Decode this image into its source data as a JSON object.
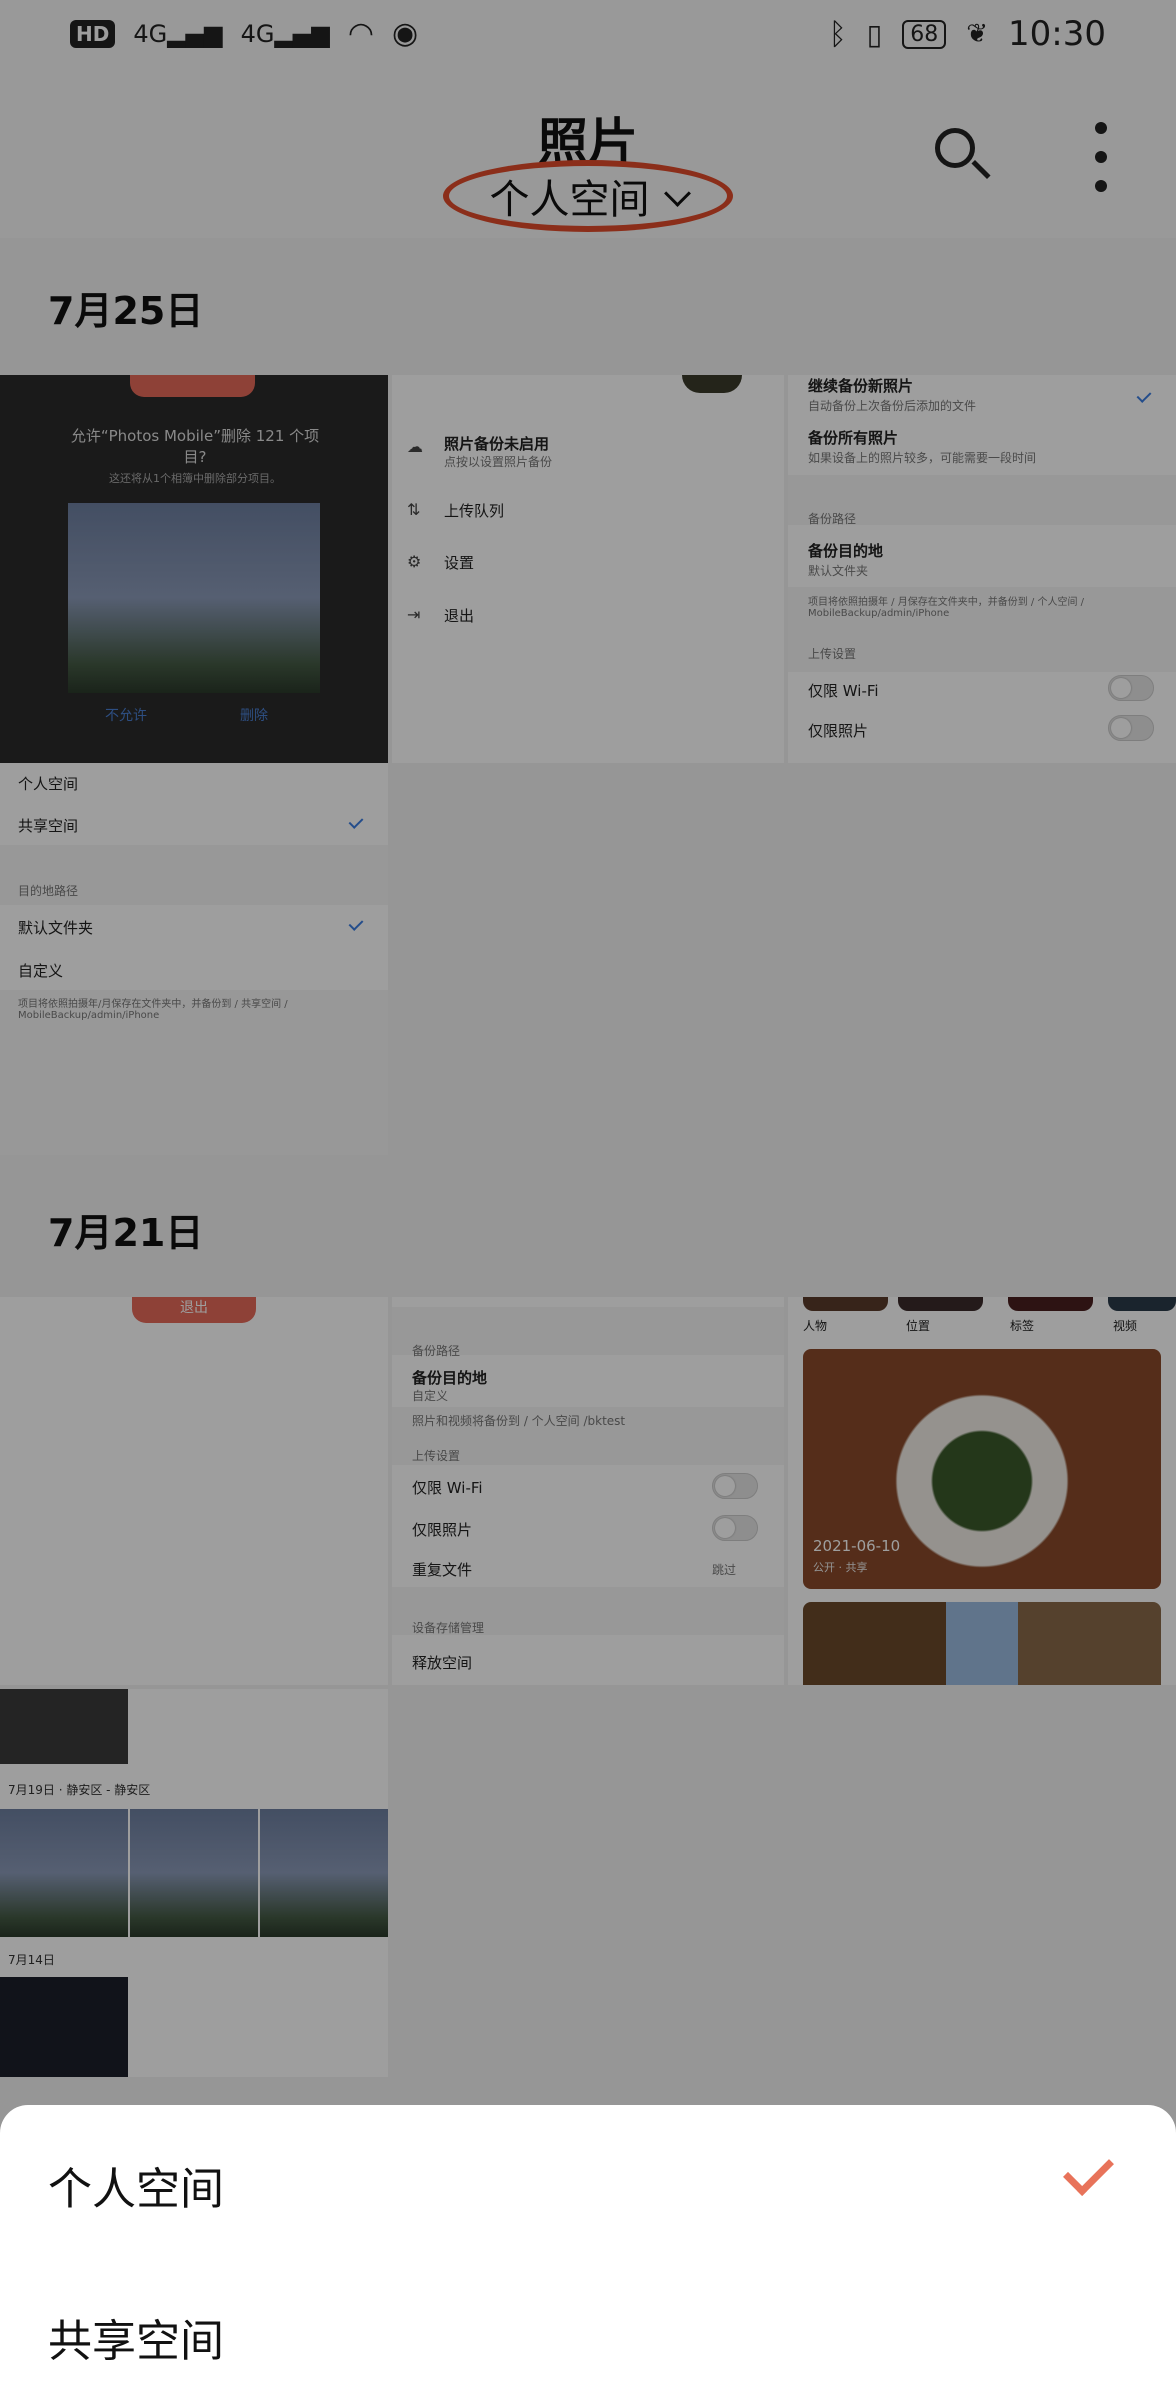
{
  "status_bar": {
    "hd": "HD",
    "sig1": "4G",
    "sig2": "4G",
    "battery": "68",
    "time": "10:30"
  },
  "app_bar": {
    "title": "照片",
    "space_selector": "个人空间"
  },
  "sections": [
    {
      "date": "7月25日"
    },
    {
      "date": "7月21日"
    }
  ],
  "thumb1": {
    "dialog_title": "允许“Photos Mobile”删除 121 个项目?",
    "dialog_sub": "这还将从1个相簿中删除部分项目。",
    "deny": "不允许",
    "delete": "删除",
    "rows": [
      "个人空间",
      "共享空间",
      "目的地路径",
      "默认文件夹",
      "自定义"
    ],
    "footer": "项目将依照拍摄年/月保存在文件夹中，并备份到 / 共享空间 / MobileBackup/admin/iPhone"
  },
  "thumb2": {
    "items": [
      "照片备份未启用",
      "上传队列",
      "设置",
      "退出"
    ],
    "sub": "点按以设置照片备份"
  },
  "thumb3": {
    "r1": "继续备份新照片",
    "r1s": "自动备份上次备份后添加的文件",
    "r2": "备份所有照片",
    "r2s": "如果设备上的照片较多，可能需要一段时间",
    "sec1": "备份路径",
    "r3": "备份目的地",
    "r3s": "默认文件夹",
    "note": "项目将依照拍摄年 / 月保存在文件夹中，并备份到 / 个人空间 / MobileBackup/admin/iPhone",
    "sec2": "上传设置",
    "r4": "仅限 Wi-Fi",
    "r5": "仅限照片"
  },
  "thumb4": {
    "btn": "退出"
  },
  "thumb5": {
    "sec1": "备份路径",
    "r1": "备份目的地",
    "r1s": "自定义",
    "note": "照片和视频将备份到 / 个人空间 /bktest",
    "sec2": "上传设置",
    "r2": "仅限 Wi-Fi",
    "r3": "仅限照片",
    "r4": "重复文件",
    "r4v": "跳过",
    "sec3": "设备存储管理",
    "r5": "释放空间"
  },
  "thumb6": {
    "cats": [
      "人物",
      "位置",
      "标签",
      "视频"
    ],
    "photo_date": "2021-06-10",
    "photo_sub": "公开 · 共享"
  },
  "thumb7": {
    "d1": "7月19日 · 静安区 - 静安区",
    "d2": "7月14日"
  },
  "sheet": {
    "options": [
      "个人空间",
      "共享空间"
    ]
  }
}
